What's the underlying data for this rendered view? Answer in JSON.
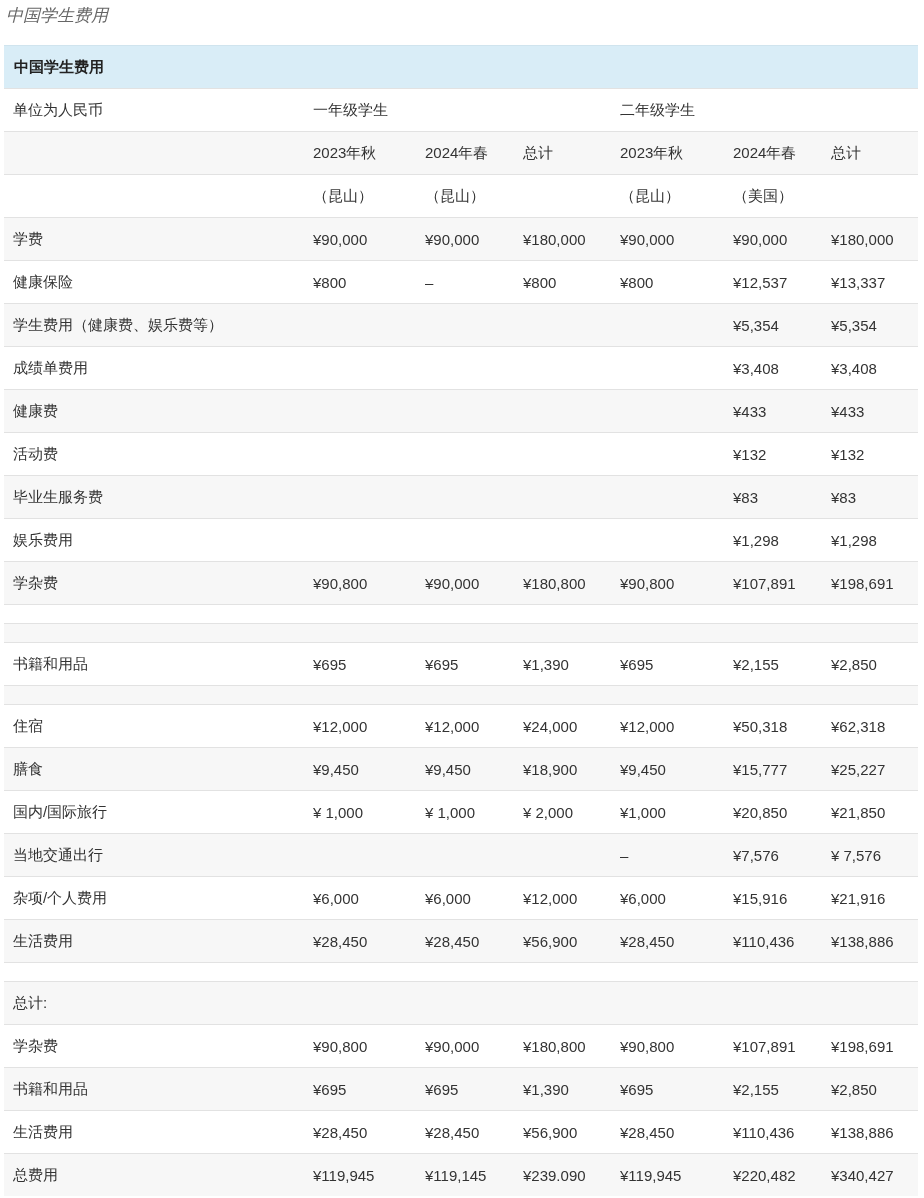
{
  "caption": "中国学生费用",
  "table": {
    "title": "中国学生费用",
    "rows": [
      {
        "kind": "data",
        "cells": [
          "单位为人民币",
          "一年级学生",
          null,
          null,
          "二年级学生",
          null,
          null
        ]
      },
      {
        "kind": "data",
        "cells": [
          null,
          "2023年秋",
          "2024年春",
          "总计",
          "2023年秋",
          "2024年春",
          "总计"
        ]
      },
      {
        "kind": "data",
        "cells": [
          null,
          "（昆山）",
          "（昆山）",
          null,
          "（昆山）",
          "（美国）",
          null
        ]
      },
      {
        "kind": "data",
        "cells": [
          "学费",
          "¥90,000",
          "¥90,000",
          "¥180,000",
          "¥90,000",
          "¥90,000",
          "¥180,000"
        ]
      },
      {
        "kind": "data",
        "cells": [
          "健康保险",
          " ¥800",
          "–",
          "¥800",
          "¥800",
          "¥12,537",
          "¥13,337"
        ]
      },
      {
        "kind": "data",
        "cells": [
          "学生费用（健康费、娱乐费等）",
          null,
          null,
          null,
          null,
          "¥5,354",
          "¥5,354"
        ]
      },
      {
        "kind": "data",
        "cells": [
          "成绩单费用",
          null,
          null,
          null,
          null,
          "¥3,408",
          "¥3,408"
        ]
      },
      {
        "kind": "data",
        "cells": [
          "健康费",
          null,
          null,
          null,
          null,
          "¥433",
          "¥433"
        ]
      },
      {
        "kind": "data",
        "cells": [
          "活动费",
          null,
          null,
          null,
          null,
          "¥132",
          "¥132"
        ]
      },
      {
        "kind": "data",
        "cells": [
          "毕业生服务费",
          null,
          null,
          null,
          null,
          "¥83",
          "¥83"
        ]
      },
      {
        "kind": "data",
        "cells": [
          "娱乐费用",
          null,
          null,
          null,
          null,
          "¥1,298",
          "¥1,298"
        ]
      },
      {
        "kind": "data",
        "cells": [
          "学杂费",
          "¥90,800",
          "¥90,000",
          "¥180,800",
          "¥90,800",
          "¥107,891",
          "¥198,691"
        ]
      },
      {
        "kind": "spacer"
      },
      {
        "kind": "spacer"
      },
      {
        "kind": "data",
        "cells": [
          "书籍和用品",
          "¥695",
          "¥695",
          "¥1,390",
          "¥695",
          "¥2,155",
          "¥2,850"
        ]
      },
      {
        "kind": "spacer"
      },
      {
        "kind": "data",
        "cells": [
          "住宿",
          "¥12,000",
          "¥12,000",
          "¥24,000",
          "¥12,000",
          "¥50,318",
          "¥62,318"
        ]
      },
      {
        "kind": "data",
        "cells": [
          "膳食",
          "¥9,450",
          "¥9,450",
          "¥18,900",
          "¥9,450",
          "¥15,777",
          "¥25,227"
        ]
      },
      {
        "kind": "data",
        "cells": [
          "国内/国际旅行",
          "¥ 1,000",
          "¥ 1,000",
          "¥ 2,000",
          "¥1,000",
          "¥20,850",
          "¥21,850"
        ]
      },
      {
        "kind": "data",
        "cells": [
          "当地交通出行",
          null,
          null,
          null,
          "–",
          "¥7,576",
          "¥ 7,576"
        ]
      },
      {
        "kind": "data",
        "cells": [
          "杂项/个人费用",
          "¥6,000",
          "¥6,000",
          "¥12,000",
          "¥6,000",
          "¥15,916",
          "¥21,916"
        ]
      },
      {
        "kind": "data",
        "cells": [
          "生活费用",
          "¥28,450",
          "¥28,450",
          "¥56,900",
          "¥28,450",
          "¥110,436",
          "¥138,886"
        ]
      },
      {
        "kind": "spacer"
      },
      {
        "kind": "data",
        "cells": [
          "总计:",
          null,
          null,
          null,
          null,
          null,
          null
        ]
      },
      {
        "kind": "data",
        "cells": [
          "学杂费",
          "¥90,800",
          "¥90,000",
          "¥180,800",
          "¥90,800",
          "¥107,891",
          "¥198,691"
        ]
      },
      {
        "kind": "data",
        "cells": [
          "书籍和用品",
          "¥695",
          "¥695",
          "¥1,390",
          "¥695",
          "¥2,155",
          "¥2,850"
        ]
      },
      {
        "kind": "data",
        "cells": [
          "生活费用",
          "¥28,450",
          "¥28,450",
          "¥56,900",
          "¥28,450",
          "¥110,436",
          "¥138,886"
        ]
      },
      {
        "kind": "data",
        "cells": [
          "总费用",
          "¥119,945",
          "¥119,145",
          "¥239.090",
          "¥119,945",
          "¥220,482",
          "¥340,427"
        ]
      }
    ]
  }
}
